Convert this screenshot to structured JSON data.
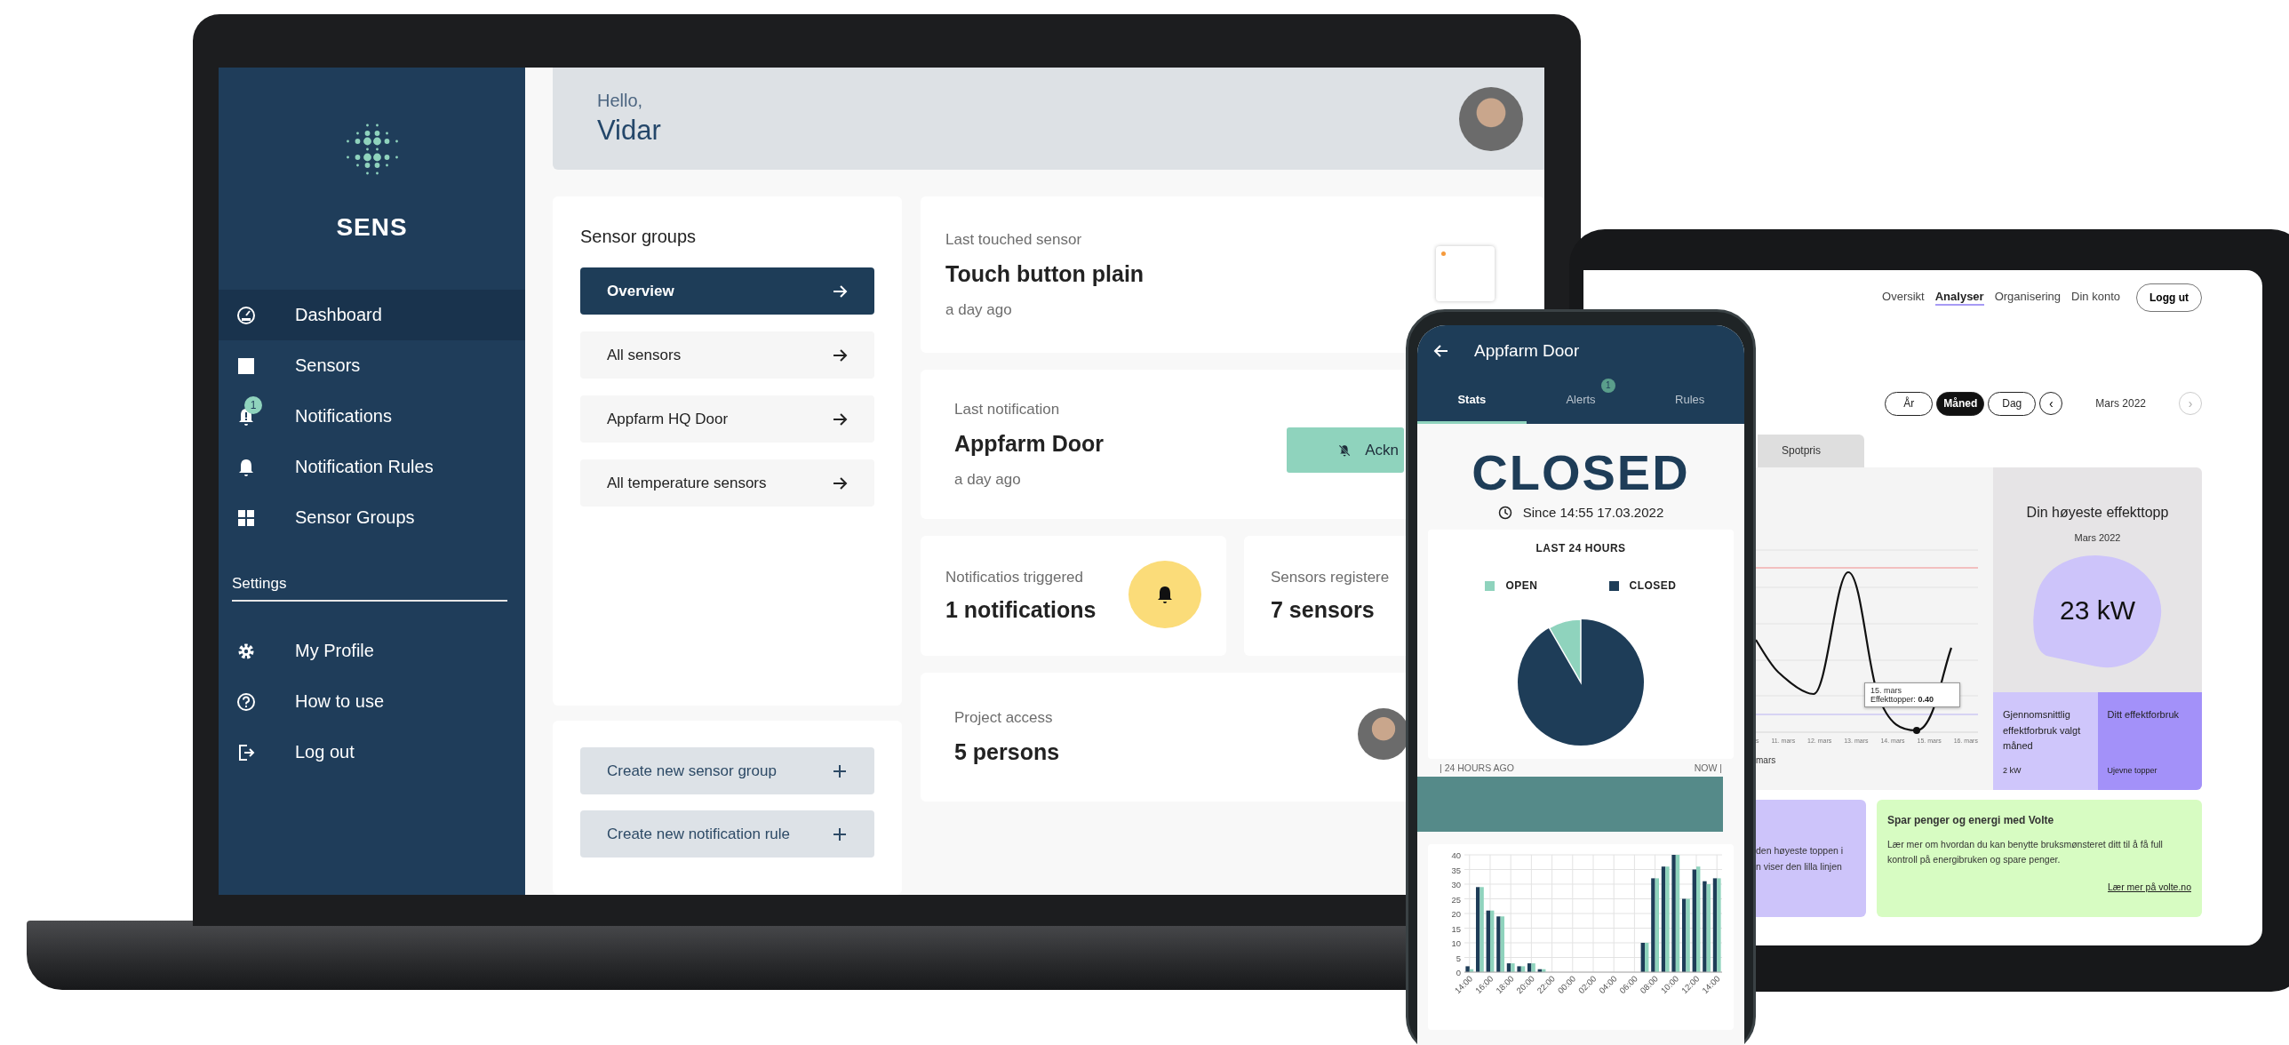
{
  "laptop": {
    "sidebar": {
      "brand": "SENS",
      "items": [
        {
          "label": "Dashboard",
          "selected": true
        },
        {
          "label": "Sensors",
          "selected": false
        },
        {
          "label": "Notifications",
          "badge": "1",
          "selected": false
        },
        {
          "label": "Notification Rules",
          "selected": false
        },
        {
          "label": "Sensor Groups",
          "selected": false
        }
      ],
      "settings_heading": "Settings",
      "settings_items": [
        {
          "label": "My Profile"
        },
        {
          "label": "How to use"
        },
        {
          "label": "Log out"
        }
      ]
    },
    "header": {
      "greeting": "Hello,",
      "name": "Vidar"
    },
    "sensor_groups": {
      "title": "Sensor groups",
      "items": [
        {
          "label": "Overview",
          "selected": true
        },
        {
          "label": "All sensors",
          "selected": false
        },
        {
          "label": "Appfarm HQ Door",
          "selected": false
        },
        {
          "label": "All temperature sensors",
          "selected": false
        }
      ]
    },
    "actions": [
      "Create new sensor group",
      "Create new notification rule"
    ],
    "last_touched": {
      "label": "Last touched sensor",
      "value": "Touch button plain",
      "time": "a day ago"
    },
    "last_notification": {
      "label": "Last notification",
      "value": "Appfarm Door",
      "time": "a day ago",
      "button": "Ackn"
    },
    "stats": [
      {
        "label": "Notificatios triggered",
        "value": "1 notifications"
      },
      {
        "label": "Sensors registere",
        "value": "7 sensors"
      }
    ],
    "project_access": {
      "label": "Project access",
      "value": "5 persons"
    }
  },
  "phone": {
    "title": "Appfarm Door",
    "tabs": [
      {
        "label": "Stats",
        "selected": true
      },
      {
        "label": "Alerts",
        "badge": "1",
        "selected": false
      },
      {
        "label": "Rules",
        "selected": false
      }
    ],
    "status": "CLOSED",
    "since": "Since 14:55 17.03.2022",
    "pie": {
      "title": "LAST 24 HOURS",
      "legend": [
        {
          "label": "OPEN",
          "color": "#8fd3bd"
        },
        {
          "label": "CLOSED",
          "color": "#1e3d58"
        }
      ]
    },
    "timeline": {
      "start": "| 24 HOURS AGO",
      "end": "NOW |"
    },
    "bar_chart": {
      "chart_data": {
        "type": "bar",
        "categories": [
          "14:00",
          null,
          "16:00",
          null,
          "18:00",
          null,
          "20:00",
          null,
          "22:00",
          null,
          "00:00",
          null,
          "02:00",
          null,
          "04:00",
          null,
          "06:00",
          null,
          "08:00",
          null,
          "10:00",
          null,
          "12:00",
          null,
          "14:00"
        ],
        "series": [
          {
            "color": "#1e3d58",
            "values": [
              2,
              29,
              21,
              19,
              3,
              2,
              3,
              1,
              0,
              0,
              0,
              0,
              0,
              0,
              0,
              0,
              0,
              10,
              32,
              36,
              40,
              25,
              35,
              31,
              32
            ]
          },
          {
            "color": "#8fd3bd",
            "values": [
              1,
              29,
              21,
              19,
              3,
              2,
              3,
              1,
              0,
              0,
              0,
              0,
              0,
              0,
              0,
              0,
              0,
              10,
              32,
              36,
              40,
              25,
              36,
              30,
              32
            ]
          }
        ],
        "ylim": [
          0,
          40
        ],
        "yticks": [
          0,
          5,
          10,
          15,
          20,
          25,
          30,
          35,
          40
        ],
        "grid": true
      }
    }
  },
  "tablet": {
    "nav": [
      {
        "label": "Oversikt",
        "selected": false
      },
      {
        "label": "Analyser",
        "selected": true
      },
      {
        "label": "Organisering",
        "selected": false
      },
      {
        "label": "Din konto",
        "selected": false
      }
    ],
    "logout": "Logg ut",
    "periods": [
      {
        "label": "År",
        "selected": false
      },
      {
        "label": "Måned",
        "selected": true
      },
      {
        "label": "Dag",
        "selected": false
      }
    ],
    "prev": "‹",
    "period_label": "Mars 2022",
    "next": "›",
    "tab": "Spotpris",
    "chart": {
      "x_labels": [
        "s",
        "11. mars",
        "12. mars",
        "13. mars",
        "14. mars",
        "15. mars",
        "16. mars"
      ],
      "caption": "mars",
      "tooltip": {
        "date": "15. mars",
        "text": "Effekttopper: **0.40**"
      }
    },
    "peak": {
      "title": "Din høyeste effekttopp",
      "period": "Mars 2022",
      "value": "23 kW"
    },
    "tiles": [
      {
        "kind": "light",
        "title": "Gjennomsnittlig effektforbruk valgt måned",
        "value": "2 kW"
      },
      {
        "kind": "dark",
        "title": "Ditt effektforbruk",
        "value": "Ujevne topper"
      }
    ],
    "info_left": {
      "lines": [
        "den høyeste toppen i",
        "n viser den lilla linjen"
      ]
    },
    "info_right": {
      "title": "Spar penger og energi med Volte",
      "text": "Lær mer om hvordan du kan benytte bruksmønsteret ditt til å få full kontroll på energibruken og spare penger.",
      "link": "Lær mer på volte.no"
    }
  }
}
